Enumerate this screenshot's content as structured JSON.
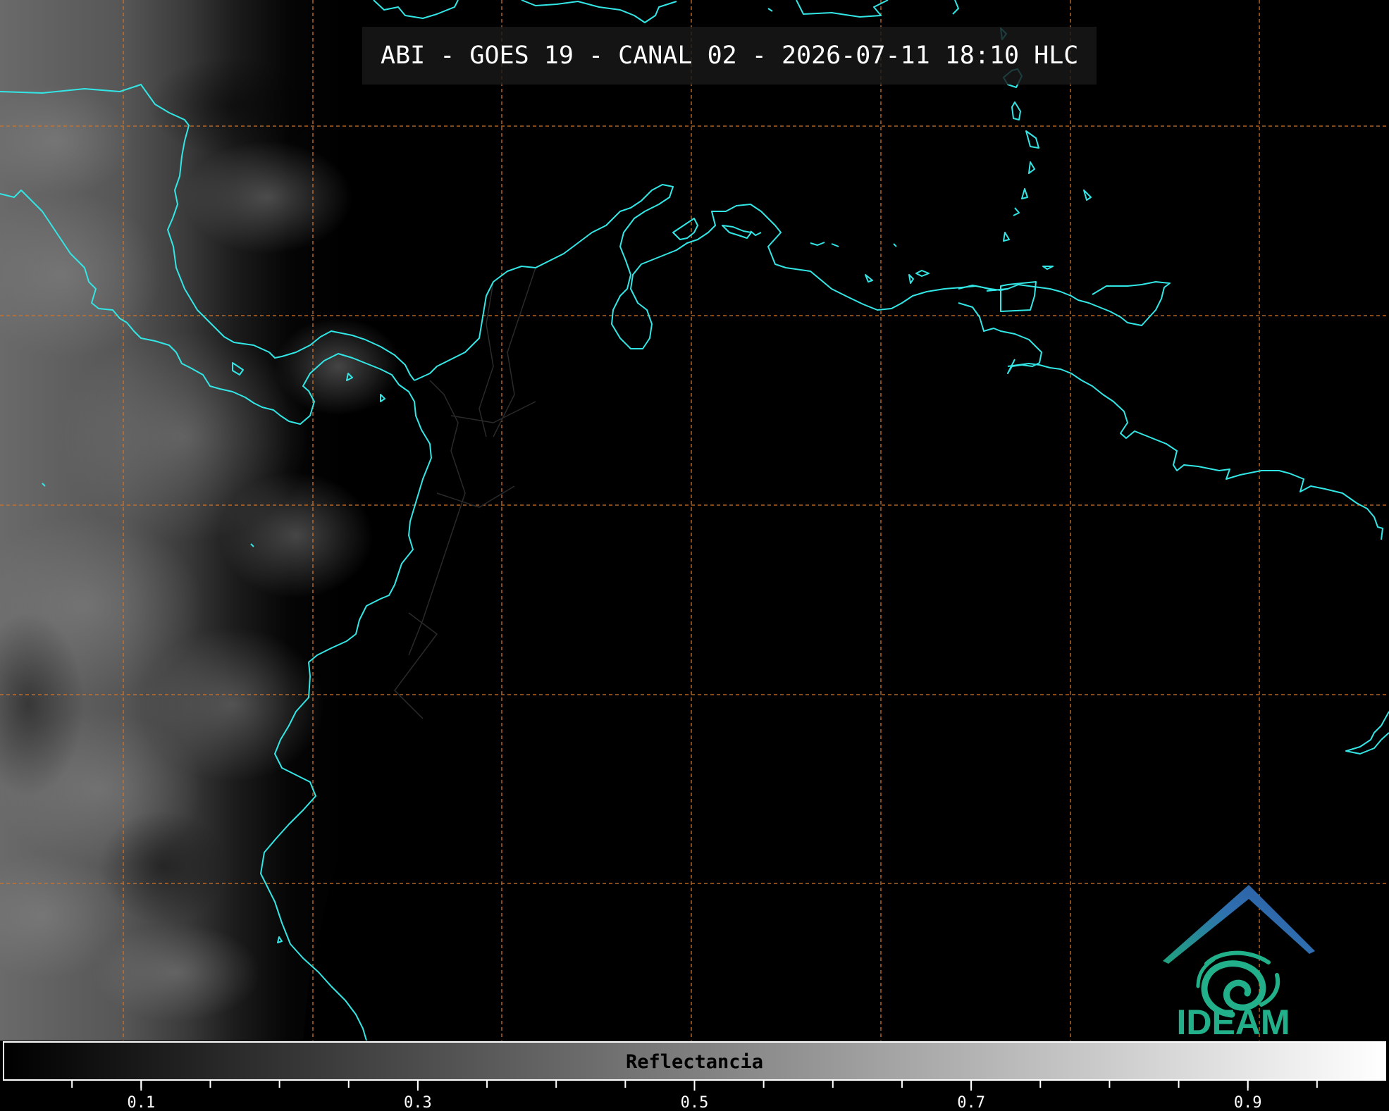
{
  "header": {
    "title": "ABI - GOES 19 - CANAL 02 - 2026-07-11 18:10 HLC"
  },
  "colorbar": {
    "label": "Reflectancia",
    "min": 0.0,
    "max": 1.0,
    "tick_labels": [
      "0.1",
      "0.3",
      "0.5",
      "0.7",
      "0.9"
    ],
    "tick_values": [
      0.1,
      0.3,
      0.5,
      0.7,
      0.9
    ],
    "minor_tick_step": 0.05,
    "gradient_from": "#000000",
    "gradient_to": "#ffffff"
  },
  "logo": {
    "text": "IDEAM",
    "roof_color_left": "#1fa37e",
    "roof_color_right": "#2f6fb0",
    "spiral_color": "#22b08a"
  },
  "colors": {
    "coastline": "#33e6e6",
    "gridline": "#d0742a",
    "borders": "#2a2a2a",
    "background": "#000000"
  },
  "map": {
    "imagery_description_visible": false
  }
}
